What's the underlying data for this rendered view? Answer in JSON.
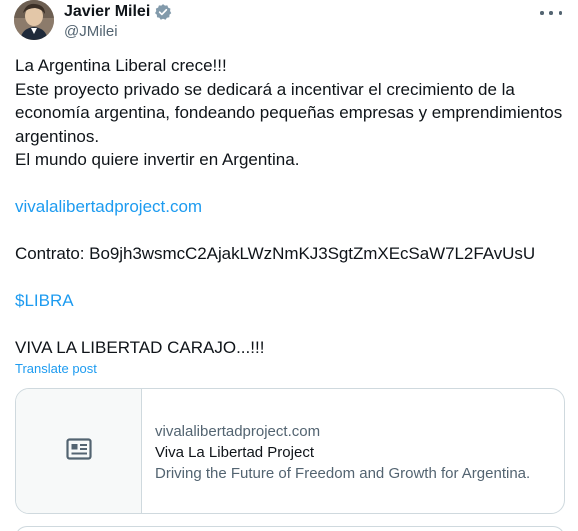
{
  "author": {
    "display_name": "Javier Milei",
    "handle": "@JMilei",
    "verified_icon": "verified-badge-icon",
    "verified_color": "#829aab"
  },
  "tweet": {
    "lines": [
      "La Argentina Liberal crece!!!",
      "Este proyecto privado se dedicará a incentivar el crecimiento de la",
      "economía argentina, fondeando pequeñas empresas y emprendimientos",
      "argentinos.",
      "El mundo quiere invertir en Argentina."
    ],
    "link": "vivalalibertadproject.com",
    "contract": "Contrato: Bo9jh3wsmcC2AjakLWzNmKJ3SgtZmXEcSaW7L2FAvUsU",
    "cashtag": "$LIBRA",
    "closing": "VIVA LA LIBERTAD CARAJO...!!!"
  },
  "translate_label": "Translate post",
  "card": {
    "domain": "vivalalibertadproject.com",
    "title": "Viva La Libertad Project",
    "description": "Driving the Future of Freedom and Growth for Argentina.",
    "thumb_icon": "article-icon"
  },
  "colors": {
    "link": "#1d9bf0",
    "text": "#0f1419",
    "secondary": "#536471",
    "border": "#cfd9de"
  }
}
